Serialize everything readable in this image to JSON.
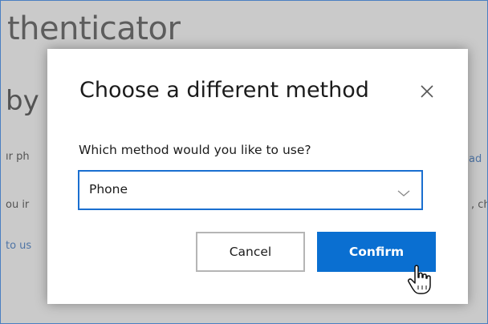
{
  "background": {
    "title": "thenticator",
    "subtitle": "by",
    "lines": {
      "line1": "ır ph",
      "line2": "ou ir",
      "line3": "to us"
    },
    "right": {
      "right1": "ad",
      "right2": ", ch"
    }
  },
  "dialog": {
    "title": "Choose a different method",
    "close_icon": "close-icon",
    "field_label": "Which method would you like to use?",
    "select": {
      "value": "Phone",
      "icon": "chevron-down-icon"
    },
    "buttons": {
      "cancel_label": "Cancel",
      "confirm_label": "Confirm"
    }
  },
  "colors": {
    "accent": "#0a6fd1",
    "focus_border": "#1a6fd0",
    "link": "#2a6cc0",
    "overlay": "rgba(128,128,128,0.42)"
  }
}
